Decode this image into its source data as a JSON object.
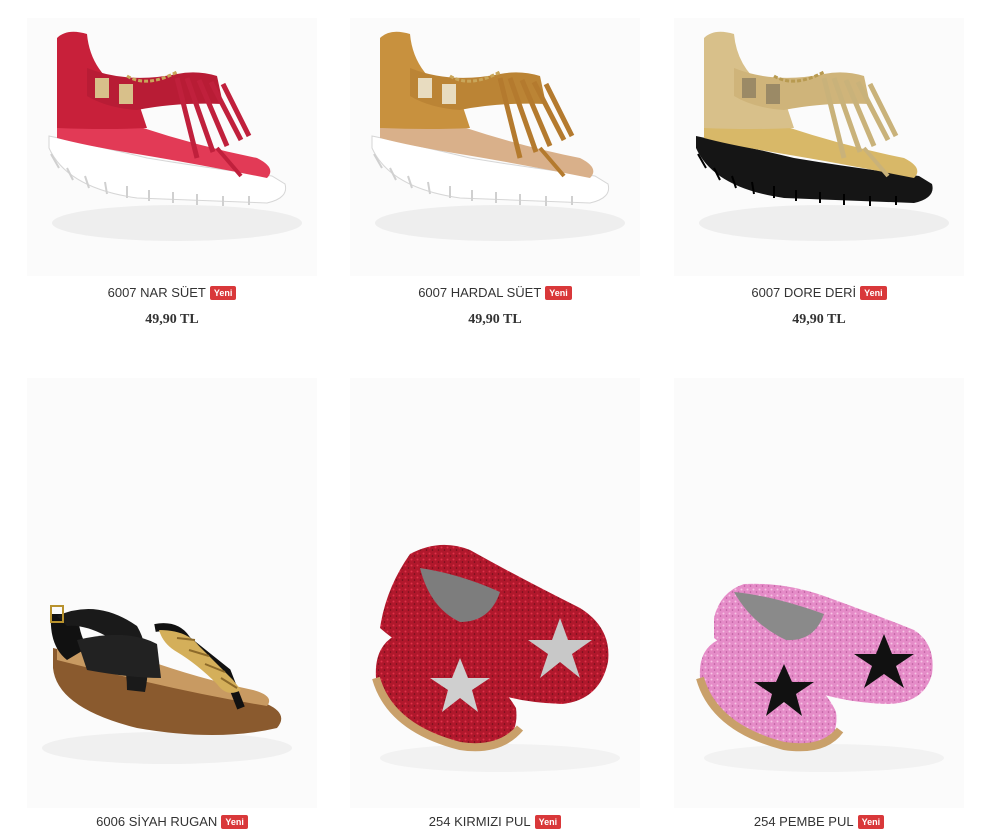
{
  "products": [
    {
      "name": "6007 NAR SÜET",
      "badge": "Yeni",
      "price": "49,90 TL",
      "image": "red-fringe-sandal"
    },
    {
      "name": "6007 HARDAL SÜET",
      "badge": "Yeni",
      "price": "49,90 TL",
      "image": "mustard-fringe-sandal"
    },
    {
      "name": "6007 DORE DERİ",
      "badge": "Yeni",
      "price": "49,90 TL",
      "image": "gold-fringe-sandal"
    },
    {
      "name": "6006 SİYAH RUGAN",
      "badge": "Yeni",
      "price": "",
      "image": "black-patent-thong-sandal"
    },
    {
      "name": "254 KIRMIZI PUL",
      "badge": "Yeni",
      "price": "",
      "image": "red-glitter-espadrille"
    },
    {
      "name": "254 PEMBE PUL",
      "badge": "Yeni",
      "price": "",
      "image": "pink-glitter-espadrille"
    }
  ],
  "colors": {
    "badge": "#d9383a",
    "text": "#333333",
    "red": "#c8203a",
    "mustard": "#c8913e",
    "gold": "#d8c08a",
    "black": "#111111",
    "pink": "#e58cc8"
  }
}
